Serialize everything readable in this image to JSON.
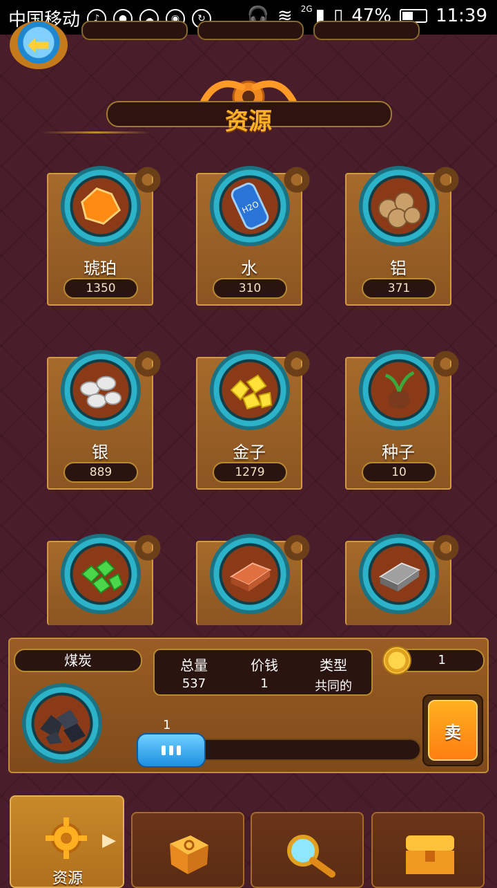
{
  "status": {
    "carrier": "中国移动",
    "net": "2G",
    "battery": "47%",
    "battery_fill": 0.47,
    "time": "11:39"
  },
  "title": "资源",
  "resources": [
    {
      "name": "琥珀",
      "value": "1350",
      "art": "amber-icon",
      "color": "#ff8a12"
    },
    {
      "name": "水",
      "value": "310",
      "art": "water-barrel-icon",
      "color": "#2a74d8"
    },
    {
      "name": "铝",
      "value": "371",
      "art": "aluminum-ore-icon",
      "color": "#c9a06a"
    },
    {
      "name": "银",
      "value": "889",
      "art": "silver-ore-icon",
      "color": "#e8e8e8"
    },
    {
      "name": "金子",
      "value": "1279",
      "art": "gold-ore-icon",
      "color": "#ffe13a"
    },
    {
      "name": "种子",
      "value": "10",
      "art": "seed-icon",
      "color": "#3aa83a"
    },
    {
      "name": "",
      "value": "",
      "art": "emerald-icon",
      "color": "#4ad84a"
    },
    {
      "name": "",
      "value": "",
      "art": "copper-ingot-icon",
      "color": "#e07040"
    },
    {
      "name": "",
      "value": "",
      "art": "iron-ingot-icon",
      "color": "#a0a0a0"
    }
  ],
  "detail": {
    "name": "煤炭",
    "total_label": "总量",
    "total": "537",
    "price_label": "价钱",
    "price": "1",
    "type_label": "类型",
    "type": "共同的",
    "coins": "1",
    "slider_value": "1",
    "sell_label": "卖"
  },
  "nav": {
    "active_label": "资源"
  }
}
